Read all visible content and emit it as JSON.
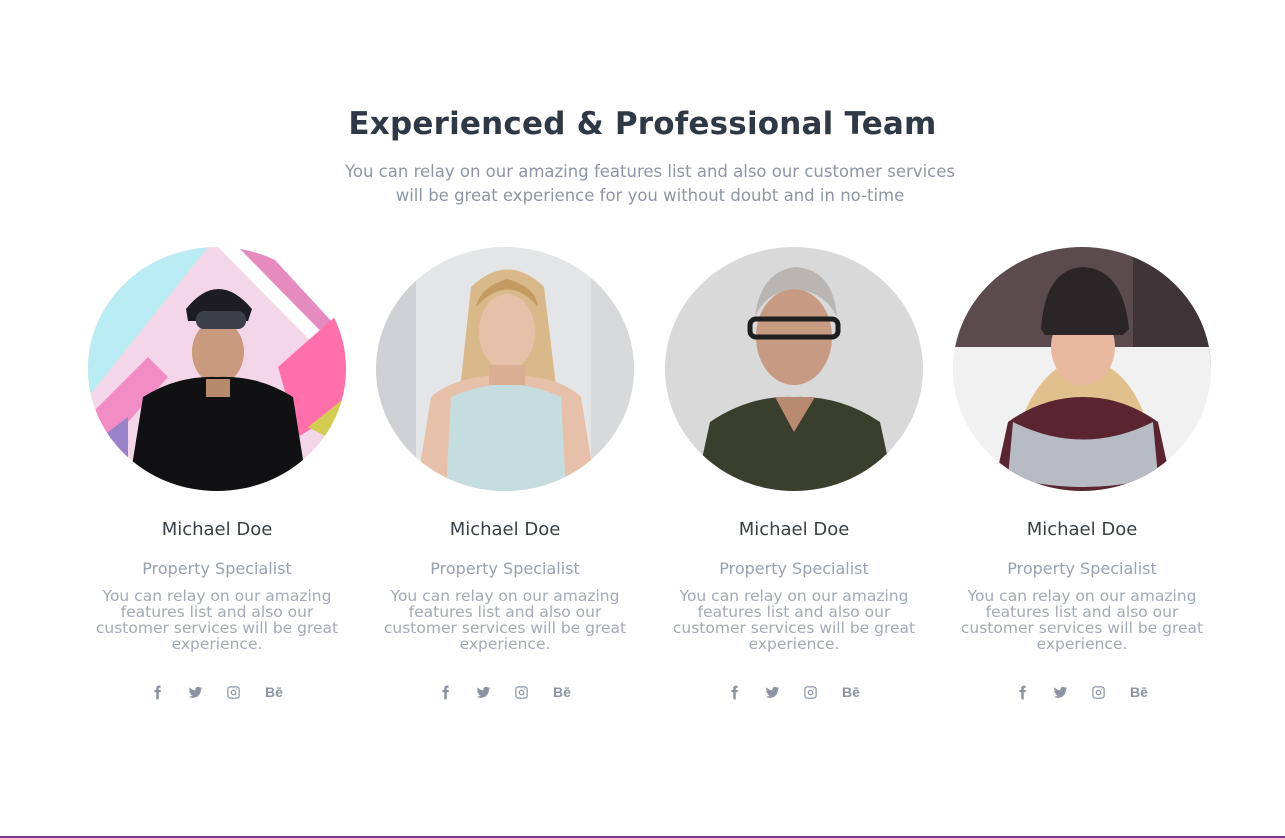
{
  "header": {
    "title": "Experienced & Professional Team",
    "subtitle": "You can relay on our amazing features list and also our customer services will be great experience for you without doubt and in no-time"
  },
  "team": [
    {
      "name": "Michael Doe",
      "role": "Property Specialist",
      "bio": "You can relay on our amazing features list and also our customer services will be great experience.",
      "social": [
        "facebook-icon",
        "twitter-icon",
        "instagram-icon",
        "behance-icon"
      ]
    },
    {
      "name": "Michael Doe",
      "role": "Property Specialist",
      "bio": "You can relay on our amazing features list and also our customer services will be great experience.",
      "social": [
        "facebook-icon",
        "twitter-icon",
        "instagram-icon",
        "behance-icon"
      ]
    },
    {
      "name": "Michael Doe",
      "role": "Property Specialist",
      "bio": "You can relay on our amazing features list and also our customer services will be great experience.",
      "social": [
        "facebook-icon",
        "twitter-icon",
        "instagram-icon",
        "behance-icon"
      ]
    },
    {
      "name": "Michael Doe",
      "role": "Property Specialist",
      "bio": "You can relay on our amazing features list and also our customer services will be great experience.",
      "social": [
        "facebook-icon",
        "twitter-icon",
        "instagram-icon",
        "behance-icon"
      ]
    }
  ],
  "social_labels": {
    "behance": "Bē"
  },
  "colors": {
    "title": "#2f3845",
    "muted": "#8d95a5",
    "icon": "#8c94a4"
  }
}
